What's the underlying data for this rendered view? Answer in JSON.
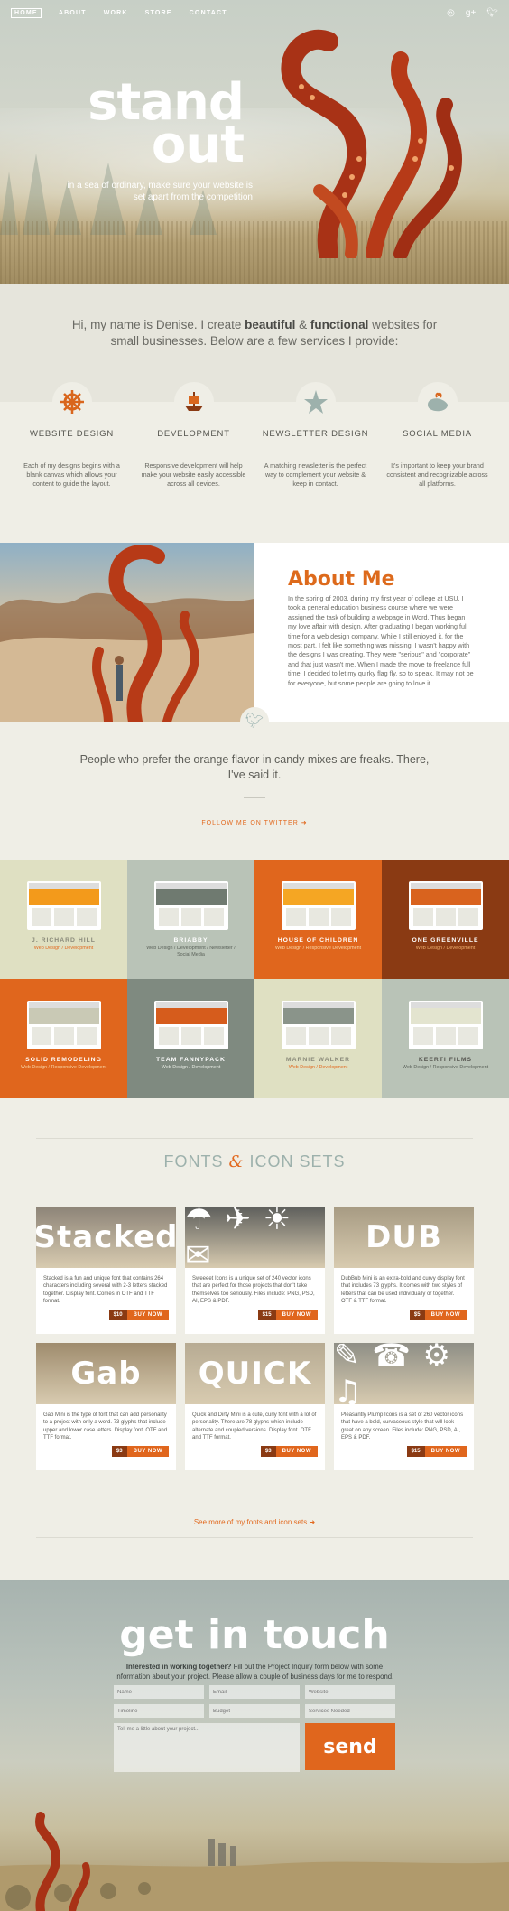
{
  "nav": {
    "items": [
      "HOME",
      "ABOUT",
      "WORK",
      "STORE",
      "CONTACT"
    ],
    "social": [
      "dribbble-icon",
      "google-plus-icon",
      "twitter-icon"
    ]
  },
  "hero": {
    "title_1": "stand",
    "title_2": "out",
    "subtitle": "in a sea of ordinary, make sure your website is set apart from the competition"
  },
  "intro": {
    "pre": "Hi, my name is Denise. I create ",
    "b1": "beautiful",
    "mid": " & ",
    "b2": "functional",
    "post": " websites for small businesses. Below are a few services I provide:"
  },
  "services": [
    {
      "icon": "ships-wheel-icon",
      "title": "WEBSITE DESIGN",
      "text": "Each of my designs begins with a blank canvas which allows your content to guide the layout."
    },
    {
      "icon": "ship-icon",
      "title": "DEVELOPMENT",
      "text": "Responsive development will help make your website easily accessible across all devices."
    },
    {
      "icon": "starfish-icon",
      "title": "NEWSLETTER DESIGN",
      "text": "A matching newsletter is the perfect way to complement your website & keep in contact."
    },
    {
      "icon": "whale-icon",
      "title": "SOCIAL MEDIA",
      "text": "It's important to keep your brand consistent and recognizable across all platforms."
    }
  ],
  "about": {
    "title": "About Me",
    "text": "In the spring of 2003, during my first year of college at USU, I took a general education business course where we were assigned the task of building a webpage in Word. Thus began my love affair with design. After graduating I began working full time for a web design company. While I still enjoyed it, for the most part, I felt like something was missing. I wasn't happy with the designs I was creating. They were \"serious\" and \"corporate\" and that just wasn't me. When I made the move to freelance full time, I decided to let my quirky flag fly, so to speak. It may not be for everyone, but some people are going to love it."
  },
  "tweet": {
    "text": "People who prefer the orange flavor in candy mixes are freaks. There, I've said it.",
    "link": "FOLLOW ME ON TWITTER ➜"
  },
  "portfolio": [
    {
      "name": "J. RICHARD HILL",
      "tags": "Web Design / Development",
      "bg": "#dfe0c2",
      "fg": "#8a8a7a",
      "tag": "#e26a20",
      "accent": "#f39a1b"
    },
    {
      "name": "BRIABBY",
      "tags": "Web Design / Development / Newsletter / Social Media",
      "bg": "#b9c3b7",
      "fg": "#ffffff",
      "tag": "#5b625a",
      "accent": "#6f7a70"
    },
    {
      "name": "HOUSE OF CHILDREN",
      "tags": "Web Design / Responsive Development",
      "bg": "#e0661d",
      "fg": "#ffffff",
      "tag": "#f8d7a8",
      "accent": "#f5a623"
    },
    {
      "name": "ONE GREENVILLE",
      "tags": "Web Design / Development",
      "bg": "#8a3a13",
      "fg": "#ffffff",
      "tag": "#f0b070",
      "accent": "#d9631e"
    },
    {
      "name": "SOLID REMODELING",
      "tags": "Web Design / Responsive Development",
      "bg": "#e0661d",
      "fg": "#ffffff",
      "tag": "#f8d7a8",
      "accent": "#c9c9b5"
    },
    {
      "name": "TEAM FANNYPACK",
      "tags": "Web Design / Development",
      "bg": "#7f8a80",
      "fg": "#ffffff",
      "tag": "#e7ebe3",
      "accent": "#d65c1c"
    },
    {
      "name": "MARNIE WALKER",
      "tags": "Web Design / Development",
      "bg": "#dfe0c2",
      "fg": "#8a8a7a",
      "tag": "#e26a20",
      "accent": "#8a948a"
    },
    {
      "name": "KEERTI FILMS",
      "tags": "Web Design / Responsive Development",
      "bg": "#b9c3b7",
      "fg": "#55554f",
      "tag": "#5b625a",
      "accent": "#e3e4cf"
    }
  ],
  "fonts": {
    "title_a": "FONTS ",
    "amp": "&",
    "title_b": " ICON SETS",
    "cards": [
      {
        "word": "Stacked",
        "bg": "#8d8478",
        "text": "Stacked is a fun and unique font that contains 264 characters including several with 2-3 letters stacked together. Display font. Comes in OTF and TTF format.",
        "price": "$10",
        "buy": "BUY NOW"
      },
      {
        "word": "☂ ✈ ☀ ✉",
        "bg": "#5e5f5c",
        "text": "Sweeeet Icons is a unique set of 240 vector icons that are perfect for those projects that don't take themselves too seriously. Files include: PNG, PSD, AI, EPS & PDF.",
        "price": "$15",
        "buy": "BUY NOW"
      },
      {
        "word": "DUB",
        "bg": "#a79b83",
        "text": "DubBub Mini is an extra-bold and curvy display font that includes 73 glyphs. It comes with two styles of letters that can be used individually or together. OTF & TTF format.",
        "price": "$5",
        "buy": "BUY NOW"
      },
      {
        "word": "Gab",
        "bg": "#9f8c6e",
        "text": "Gab Mini is the type of font that can add personality to a project with only a word. 73 glyphs that include upper and lower case letters. Display font. OTF and TTF format.",
        "price": "$3",
        "buy": "BUY NOW"
      },
      {
        "word": "QUICK",
        "bg": "#b7ab93",
        "text": "Quick and Dirty Mini is a cute, curly font with a lot of personality. There are 78 glyphs which include alternate and coupled versions. Display font. OTF and TTF format.",
        "price": "$3",
        "buy": "BUY NOW"
      },
      {
        "word": "✎ ☎ ⚙ ♫",
        "bg": "#8f8f86",
        "text": "Pleasantly Plump Icons is a set of 260 vector icons that have a bold, curvaceous style that will look great on any screen. Files include: PNG, PSD, AI, EPS & PDF.",
        "price": "$15",
        "buy": "BUY NOW"
      }
    ],
    "more": "See more of my fonts and icon sets ➜"
  },
  "contact": {
    "title": "get in touch",
    "lead_b": "Interested in working together?",
    "lead": " Fill out the Project Inquiry form below with some information about your project. Please allow a couple of business days for me to respond.",
    "fields": {
      "name": "Name",
      "email": "Email",
      "website": "Website",
      "timeline": "Timeline",
      "budget": "Budget",
      "services": "Services Needed",
      "message": "Tell me a little about your project..."
    },
    "send": "send"
  },
  "colors": {
    "accent": "#e0661d",
    "rust": "#8a3a13",
    "sage": "#9db1ac"
  }
}
